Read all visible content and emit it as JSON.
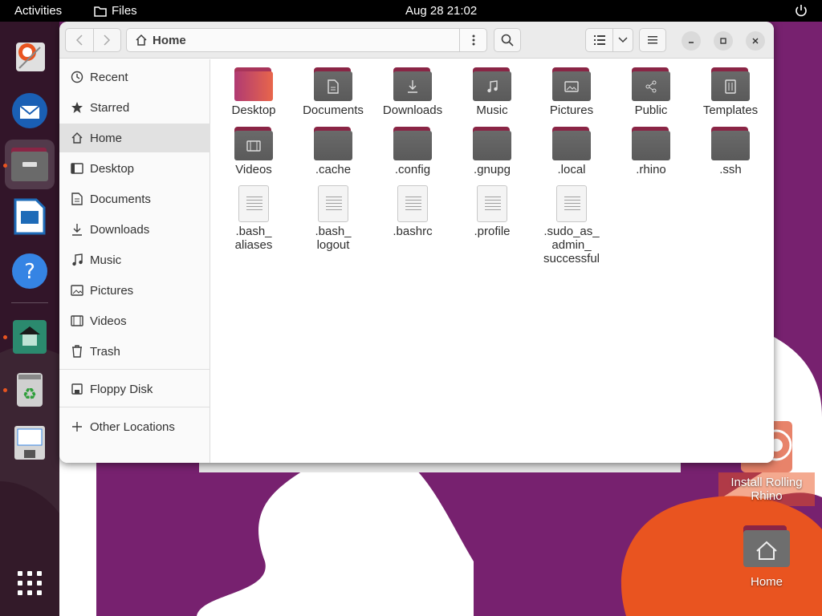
{
  "topbar": {
    "activities": "Activities",
    "app_name": "Files",
    "clock": "Aug 28  21:02"
  },
  "window": {
    "path": "Home",
    "sidebar": [
      {
        "label": "Recent",
        "icon": "clock-icon"
      },
      {
        "label": "Starred",
        "icon": "star-icon"
      },
      {
        "label": "Home",
        "icon": "home-icon",
        "selected": true
      },
      {
        "label": "Desktop",
        "icon": "desktop-icon"
      },
      {
        "label": "Documents",
        "icon": "document-icon"
      },
      {
        "label": "Downloads",
        "icon": "download-icon"
      },
      {
        "label": "Music",
        "icon": "music-icon"
      },
      {
        "label": "Pictures",
        "icon": "picture-icon"
      },
      {
        "label": "Videos",
        "icon": "video-icon"
      },
      {
        "label": "Trash",
        "icon": "trash-icon"
      },
      {
        "label": "Floppy Disk",
        "icon": "floppy-icon"
      },
      {
        "label": "Other Locations",
        "icon": "plus-icon"
      }
    ],
    "items": [
      {
        "label": "Desktop",
        "type": "folder",
        "emblem": "none"
      },
      {
        "label": "Documents",
        "type": "folder",
        "emblem": "document"
      },
      {
        "label": "Downloads",
        "type": "folder",
        "emblem": "download"
      },
      {
        "label": "Music",
        "type": "folder",
        "emblem": "music"
      },
      {
        "label": "Pictures",
        "type": "folder",
        "emblem": "picture"
      },
      {
        "label": "Public",
        "type": "folder",
        "emblem": "share"
      },
      {
        "label": "Templates",
        "type": "folder",
        "emblem": "template"
      },
      {
        "label": "Videos",
        "type": "folder",
        "emblem": "video"
      },
      {
        "label": ".cache",
        "type": "folder",
        "emblem": "none"
      },
      {
        "label": ".config",
        "type": "folder",
        "emblem": "none"
      },
      {
        "label": ".gnupg",
        "type": "folder",
        "emblem": "none"
      },
      {
        "label": ".local",
        "type": "folder",
        "emblem": "none"
      },
      {
        "label": ".rhino",
        "type": "folder",
        "emblem": "none"
      },
      {
        "label": ".ssh",
        "type": "folder",
        "emblem": "none"
      },
      {
        "label": ".bash_ aliases",
        "type": "file"
      },
      {
        "label": ".bash_ logout",
        "type": "file"
      },
      {
        "label": ".bashrc",
        "type": "file"
      },
      {
        "label": ".profile",
        "type": "file"
      },
      {
        "label": ".sudo_as_ admin_ successful",
        "type": "file"
      }
    ]
  },
  "desktop_icons": [
    {
      "label": "Install Rolling Rhino"
    },
    {
      "label": "Home"
    }
  ],
  "colors": {
    "accent": "#e95420",
    "folder_tab": "#8a2545",
    "wallpaper": "#77216f"
  }
}
